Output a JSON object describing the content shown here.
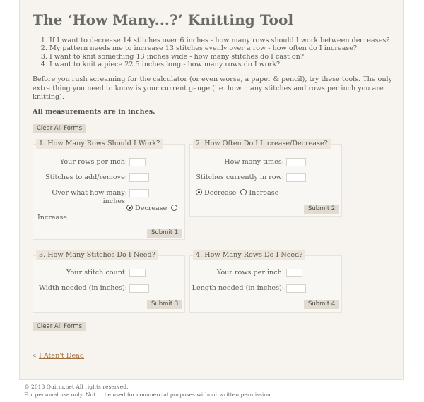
{
  "page": {
    "title": "The ‘How Many...?’ Knitting Tool",
    "questions": [
      "If I want to decrease 14 stitches over 6 inches - how many rows should I work between decreases?",
      "My pattern needs me to increase 13 stitches evenly over a row - how often do I increase?",
      "I want to knit something 13 inches wide - how many stitches do I cast on?",
      "I want to knit a piece 22.5 inches long - how many rows do I work?"
    ],
    "intro": "Before you rush screaming for the calculator (or even worse, a paper & pencil), try these tools. The only extra thing you need to know is your current gauge (i.e. how many stitches and rows per inch you are knitting).",
    "note": "All measurements are in inches.",
    "clear_all_label": "Clear All Forms"
  },
  "forms": [
    {
      "legend": "1. How Many Rows Should I Work?",
      "fields": [
        {
          "label": "Your rows per inch:",
          "value": ""
        },
        {
          "label": "Stitches to add/remove:",
          "value": ""
        },
        {
          "label": "Over what how many: inches",
          "label_line1": "Over what how many:",
          "label_line2": "inches",
          "value": ""
        }
      ],
      "radios": [
        {
          "label": "Decrease",
          "checked": true
        },
        {
          "label": "Increase",
          "checked": false
        }
      ],
      "submit": "Submit 1"
    },
    {
      "legend": "2. How Often Do I Increase/Decrease?",
      "fields": [
        {
          "label": "How many times:",
          "value": ""
        },
        {
          "label": "Stitches currently in row:",
          "value": ""
        }
      ],
      "radios": [
        {
          "label": "Decrease",
          "checked": true
        },
        {
          "label": "Increase",
          "checked": false
        }
      ],
      "submit": "Submit 2"
    },
    {
      "legend": "3. How Many Stitches Do I Need?",
      "fields": [
        {
          "label": "Your stitch count:",
          "value": ""
        },
        {
          "label": "Width needed (in inches):",
          "value": ""
        }
      ],
      "submit": "Submit 3"
    },
    {
      "legend": "4. How Many Rows Do I Need?",
      "fields": [
        {
          "label": "Your rows per inch:",
          "value": ""
        },
        {
          "label": "Length needed (in inches):",
          "value": ""
        }
      ],
      "submit": "Submit 4"
    }
  ],
  "nav": {
    "prefix": "«",
    "back_link": "I Aten't Dead"
  },
  "footer": {
    "copyright": "© 2013 Quirm.net All rights reserved.",
    "usage": "For personal use only. Not to be used for commercial purposes without written permission."
  }
}
